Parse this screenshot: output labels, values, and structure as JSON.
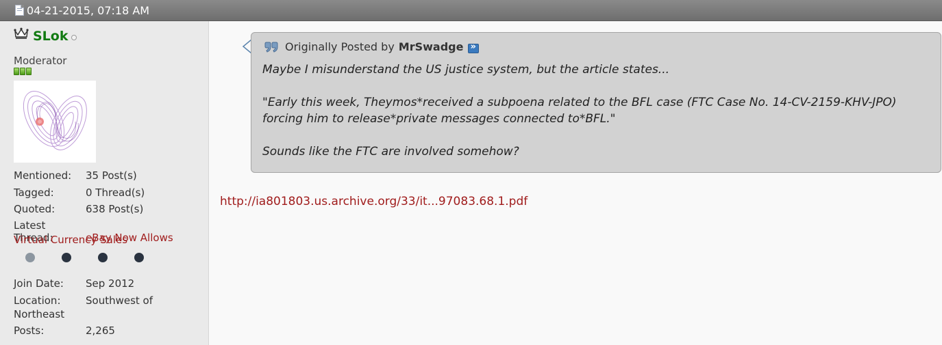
{
  "post": {
    "datetime": "04-21-2015, 07:18 AM"
  },
  "user": {
    "name": "SLok",
    "title": "Moderator",
    "stats": [
      {
        "label": "Mentioned:",
        "value": "35 Post(s)"
      },
      {
        "label": "Tagged:",
        "value": "0 Thread(s)"
      },
      {
        "label": "Quoted:",
        "value": "638 Post(s)"
      }
    ],
    "latest_thread": {
      "label": "Latest Thread:",
      "title_line1": "eBay Now Allows",
      "title_line2": "Virtual Currency Sales"
    },
    "join": {
      "label": "Join Date:",
      "value": "Sep 2012"
    },
    "location": {
      "label": "Location:",
      "value_line1": "Southwest of",
      "value_line2": "Northeast"
    },
    "posts": {
      "label": "Posts:",
      "value": "2,265"
    }
  },
  "quote": {
    "prefix": "Originally Posted by",
    "poster": "MrSwadge",
    "lines": [
      "Maybe I misunderstand the US justice system, but the article states...",
      "\"Early this week, Theymos*received a subpoena related to the BFL case (FTC Case No. 14-CV-2159-KHV-JPO)",
      "forcing him to release*private messages connected to*BFL.\"",
      "Sounds like the FTC are involved somehow?"
    ]
  },
  "link": {
    "text": "http://ia801803.us.archive.org/33/it...97083.68.1.pdf"
  },
  "colors": {
    "header_bg": "#767676",
    "username": "#127a12",
    "link": "#a01c1c",
    "quote_bg": "#d2d2d2"
  }
}
